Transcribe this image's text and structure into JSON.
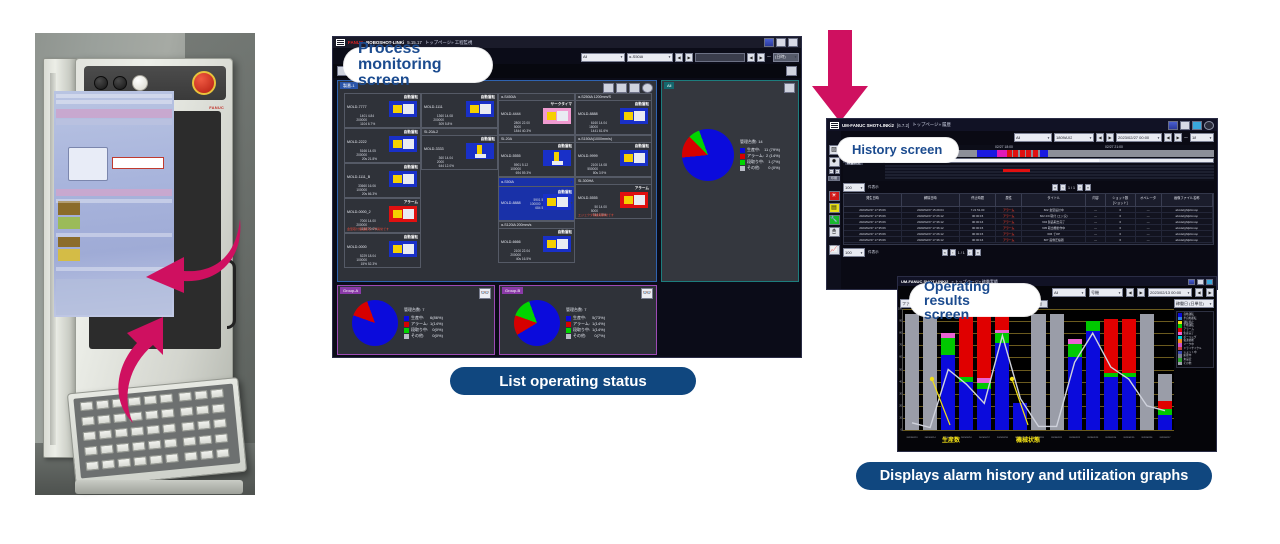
{
  "callouts": {
    "process_monitoring": "Process monitoring\nscreen",
    "history": "History screen",
    "operating_results": "Operating results\nscreen",
    "pill_list_status": "List operating status",
    "pill_alarm_history": "Displays alarm history and utilization graphs"
  },
  "photo": {
    "brand": "FANUC",
    "alt_name": "roboshot-controller-photo"
  },
  "process_window": {
    "titlebar": {
      "brand_red": "FANUC",
      "brand_white": "ROBOSHOT-LINKi",
      "version": "5.15.17",
      "breadcrumb": "トップページ» 工程監視"
    },
    "filters": {
      "group_select": "All",
      "machine_select": "α-S50iA",
      "btn_prev": "◀",
      "btn_next": "▶",
      "range_value": "",
      "tilde": "～",
      "unit_select": "(日時)"
    },
    "panel_main": {
      "tab": "製番-1"
    },
    "panel_all": {
      "tab": "All"
    },
    "tools": [
      "move-icon",
      "layout-icon",
      "sort-icon",
      "refresh-icon"
    ],
    "machine_groups": [
      {
        "name": "",
        "selected": false
      },
      {
        "name": "SI-20A-2",
        "selected": false
      },
      {
        "name": "α-S450iA",
        "selected": false
      },
      {
        "name": "α-S250iA 1200mm/S",
        "selected": false
      },
      {
        "name": "SI-20A",
        "selected": false
      },
      {
        "name": "α-S150iA(1000mm/s)",
        "selected": false
      },
      {
        "name": "α-S50iA",
        "selected": true
      },
      {
        "name": "α-S120iA 200mm/s",
        "selected": false
      },
      {
        "name": "SI-300HA",
        "selected": false
      }
    ],
    "machines": [
      {
        "id": "MOLD-7777",
        "status": "自動運転",
        "state": "run",
        "v1": "1401",
        "p1": "4.84",
        "v2": "200000",
        "v3": "1104",
        "p3": "6.7%",
        "group": ""
      },
      {
        "id": "MOLD-1111",
        "status": "自動運転",
        "state": "run",
        "v1": "1360",
        "p1": "14.08",
        "v2": "200000",
        "v3": "309",
        "p3": "5.8%",
        "group": ""
      },
      {
        "id": "MOLD-4444",
        "status": "サークタイマ",
        "state": "timer",
        "v1": "2800",
        "p1": "22.00",
        "v2": "5000",
        "v3": "1844",
        "p3": "40.3%",
        "group": "α-S450iA"
      },
      {
        "id": "MOLD-8888",
        "status": "自動運転",
        "state": "run",
        "v1": "6160",
        "p1": "14.04",
        "v2": "18000",
        "v3": "1441",
        "p3": "61.6%",
        "group": "α-S250iA 1200mm/S"
      },
      {
        "id": "MOLD-2222",
        "status": "自動運転",
        "state": "run",
        "v1": "5166",
        "p1": "14.05",
        "v2": "200000",
        "v3": "20s",
        "p3": "21.8%",
        "group": ""
      },
      {
        "id": "MOLD-3333",
        "status": "自動運転",
        "state": "run-v",
        "v1": "360",
        "p1": "14.04",
        "v2": "2000",
        "v3": "644",
        "p3": "12.0%",
        "group": "SI-20A-2"
      },
      {
        "id": "MOLD-5555",
        "status": "自動運転",
        "state": "run-v",
        "v1": "5901",
        "p1": "5.12",
        "v2": "100000",
        "v3": "694",
        "p3": "59.3%",
        "group": "SI-20A"
      },
      {
        "id": "MOLD-9999",
        "status": "自動運転",
        "state": "run",
        "v1": "2100",
        "p1": "14.08",
        "v2": "550000",
        "v3": "80s",
        "p3": "3.9%",
        "group": "α-S150iA(1000mm/s)"
      },
      {
        "id": "MOLD-1111_B",
        "status": "自動運転",
        "state": "run",
        "v1": "33660",
        "p1": "16.06",
        "v2": "100000",
        "v3": "20s",
        "p3": "66.3%",
        "group": ""
      },
      {
        "id": "MOLD-8888",
        "status": "自動運転",
        "state": "run",
        "selected": true,
        "v1": "5901",
        "p1": "5.12",
        "v2": "100000",
        "v3": "684",
        "p3": "59.3%",
        "group": "α-S50iA"
      },
      {
        "id": "MOLD-0000_2",
        "status": "アラーム",
        "state": "alarm",
        "v1": "7000",
        "p1": "14.00",
        "v2": "200000",
        "v3": "1148",
        "p3": "70.0%",
        "error": "金型取付板温度センサ異常です",
        "group": ""
      },
      {
        "id": "MOLD-6666",
        "status": "自動運転",
        "state": "run",
        "v1": "2100",
        "p1": "22.04",
        "v2": "200000",
        "v3": "40s",
        "p3": "16.5%",
        "group": "α-S120iA 200mm/s"
      },
      {
        "id": "MOLD-5555",
        "status": "アラーム",
        "state": "alarm",
        "v1": "50",
        "p1": "14.00",
        "v2": "5000",
        "v3": "744",
        "p3": "1.5%",
        "error": "エジェクタ前進限異常です",
        "group": "SI-300HA"
      },
      {
        "id": "MOLD-0000",
        "status": "自動運転",
        "state": "run",
        "v1": "5229",
        "p1": "18.04",
        "v2": "100000",
        "v3": "15%",
        "p3": "52.3%",
        "group": ""
      }
    ],
    "all_pie": {
      "title": "管理台数: 14",
      "legend": [
        {
          "label": "生産中:",
          "value": "11 (79%)",
          "color": "#0b0bdc",
          "pct": 79
        },
        {
          "label": "アラーム:",
          "value": "2 (14%)",
          "color": "#d60000",
          "pct": 14
        },
        {
          "label": "段取り中:",
          "value": "1 (7%)",
          "color": "#00d400",
          "pct": 7
        },
        {
          "label": "その他:",
          "value": "0 (0%)",
          "color": "#b9bcc6",
          "pct": 0
        }
      ]
    },
    "group_a": {
      "tab": "Group-A",
      "title": "管理台数: 7",
      "legend": [
        {
          "label": "生産中:",
          "value": "6(86%)",
          "color": "#0b0bdc",
          "pct": 86
        },
        {
          "label": "アラーム:",
          "value": "1(14%)",
          "color": "#d60000",
          "pct": 14
        },
        {
          "label": "段取り中:",
          "value": "0(0%)",
          "color": "#00d400",
          "pct": 0
        },
        {
          "label": "その他:",
          "value": "0(0%)",
          "color": "#b9bcc6",
          "pct": 0
        }
      ]
    },
    "group_b": {
      "tab": "Group-B",
      "title": "管理台数: 7",
      "legend": [
        {
          "label": "生産中:",
          "value": "5(73%)",
          "color": "#0b0bdc",
          "pct": 72
        },
        {
          "label": "アラーム:",
          "value": "1(14%)",
          "color": "#d60000",
          "pct": 14
        },
        {
          "label": "段取り中:",
          "value": "1(14%)",
          "color": "#00d400",
          "pct": 14
        },
        {
          "label": "その他:",
          "value": "0(7%)",
          "color": "#b9bcc6",
          "pct": 0
        }
      ]
    }
  },
  "history_window": {
    "titlebar": {
      "brand": "UM-FANUC SHOT-LINKi2",
      "version": "[6.7.2]",
      "breadcrumb": "トップページ» 履歴"
    },
    "filters": {
      "group_select": "All",
      "machine_select": "1809AX2",
      "date_from": "2023/02/27 00:00",
      "tilde": "～",
      "hours_select": "18"
    },
    "timeline": {
      "ticks": [
        "02/27 15:00",
        "02/27 18:00",
        "02/27 21:00"
      ],
      "row_label": "稼働状況"
    },
    "pager_top": {
      "page_size": "100",
      "label": "件表示",
      "pages": "1 / 1"
    },
    "pager_bottom": {
      "page_size": "100",
      "label": "件表示",
      "pages": "1 / 1"
    },
    "rail_icons": [
      "chart-icon",
      "gear-icon",
      "zoom-out-icon",
      "zoom-in-icon",
      "print-icon",
      "alarm-icon",
      "note-icon",
      "wrench-icon",
      "mouse-icon",
      "graph-icon"
    ],
    "table": {
      "columns": [
        "発生日時",
        "解除日時",
        "停止時間",
        "属性",
        "タイトル",
        "内容",
        "ショット数\n[ショット]",
        "オペレータ",
        "画像ファイル名称"
      ],
      "rows": [
        [
          "2023/02/27 17:35:06",
          "2023/02/27 15:29:04",
          "7.21 51.00",
          "アラーム",
          "602 金型設計中",
          "—",
          "0",
          "—",
          "abcdefghijklmnop"
        ],
        [
          "2023/02/27 17:35:06",
          "2023/02/27 17:26:12",
          "00:00:15",
          "アラーム",
          "602 2/9 取付 (エジ戻)",
          "—",
          "0",
          "—",
          "abcdefghijklmnop"
        ],
        [
          "2023/02/27 17:35:06",
          "2023/02/27 17:36:12",
          "00:00:16",
          "アラーム",
          "604 製品取出完了",
          "—",
          "0",
          "—",
          "abcdefghijklmnop"
        ],
        [
          "2023/02/27 17:35:06",
          "2023/02/27 17:36:12",
          "00:00:15",
          "アラーム",
          "605 取出機動作中",
          "—",
          "0",
          "—",
          "abcdefghijklmnop"
        ],
        [
          "2023/02/27 17:35:06",
          "2023/02/27 17:26:12",
          "00:00:15",
          "アラーム",
          "606 でOP",
          "—",
          "0",
          "—",
          "abcdefghijklmnop"
        ],
        [
          "2023/02/27 17:35:06",
          "2023/02/27 17:36:12",
          "00:00:16",
          "アラーム",
          "607 画像圧縮器",
          "—",
          "0",
          "—",
          "abcdefghijklmnop"
        ]
      ]
    }
  },
  "operating_window": {
    "titlebar": {
      "brand": "UM-FANUC SHOT-LINKi2",
      "breadcrumb": "» トップページ» 稼働実績"
    },
    "toolbar": {
      "left_select": "ファイル",
      "search_value": "",
      "search_icon": "search-icon",
      "btn_search": "集計する",
      "btn_other": "その他",
      "kind_select": "稼働率",
      "right_select": "稼働日 (日単位)"
    },
    "annotations": {
      "production_count": "生産数",
      "machine_state": "機械状態"
    },
    "chart_data": {
      "type": "bar",
      "title": "稼働実績",
      "xlabel": "",
      "ylabel": "",
      "ylim": [
        0,
        100
      ],
      "yticks": [
        "100",
        "90",
        "80",
        "70",
        "60",
        "50",
        "40",
        "30",
        "20",
        "10",
        "0"
      ],
      "categories": [
        "2023/02/13",
        "2023/02/14",
        "2023/02/15",
        "2023/02/16",
        "2023/02/17",
        "2023/02/18",
        "2023/02/19",
        "2023/02/20",
        "2023/02/21",
        "2023/02/22",
        "2023/02/23",
        "2023/02/24",
        "2023/02/25",
        "2023/02/26",
        "2023/02/27"
      ],
      "series": [
        {
          "name": "自動運転",
          "color": "#0b0bdc",
          "values": [
            0,
            0,
            62,
            40,
            34,
            72,
            22,
            0,
            0,
            60,
            82,
            44,
            44,
            0,
            12
          ]
        },
        {
          "name": "段取り中",
          "color": "#00c800",
          "values": [
            0,
            0,
            14,
            4,
            5,
            8,
            0,
            0,
            0,
            11,
            8,
            3,
            3,
            0,
            5
          ]
        },
        {
          "name": "アラーム",
          "color": "#e00000",
          "values": [
            0,
            0,
            0,
            50,
            52,
            14,
            0,
            0,
            0,
            0,
            0,
            45,
            45,
            0,
            7
          ]
        },
        {
          "name": "ソーク中",
          "color": "#ea63d2",
          "values": [
            0,
            0,
            4,
            0,
            4,
            3,
            0,
            0,
            0,
            4,
            0,
            0,
            0,
            0,
            0
          ]
        },
        {
          "name": "その他",
          "color": "#9a9da8",
          "values": [
            96,
            96,
            0,
            0,
            0,
            0,
            0,
            96,
            96,
            0,
            0,
            0,
            0,
            96,
            22
          ]
        }
      ],
      "line_series": [
        {
          "name": "生産数",
          "color": "#cfd2dc",
          "values": [
            6,
            2,
            50,
            38,
            22,
            78,
            26,
            3,
            3,
            56,
            80,
            52,
            42,
            20,
            16
          ]
        }
      ],
      "legend_position": "right",
      "legend": [
        {
          "label": "自動運転",
          "color": "#0b0bdc"
        },
        {
          "label": "半自動運転",
          "color": "#2f7fe0"
        },
        {
          "label": "運転停止",
          "color": "#f2e015"
        },
        {
          "label": "手動運転",
          "color": "#00c800"
        },
        {
          "label": "アラーム",
          "color": "#e00000"
        },
        {
          "label": "生産完了",
          "color": "#ea63d2"
        },
        {
          "label": "ポーリング",
          "color": "#00cfd4"
        },
        {
          "label": "電源遮断",
          "color": "#f08c1e"
        },
        {
          "label": "ソーク中",
          "color": "#d050c8"
        },
        {
          "label": "ドライサイクル",
          "color": "#c84040"
        },
        {
          "label": "シャット中",
          "color": "#3c4ab0"
        },
        {
          "label": "処理中",
          "color": "#7a7f90"
        },
        {
          "label": "未設定",
          "color": "#2ea02e"
        },
        {
          "label": "その他",
          "color": "#9a9da8"
        }
      ]
    }
  }
}
